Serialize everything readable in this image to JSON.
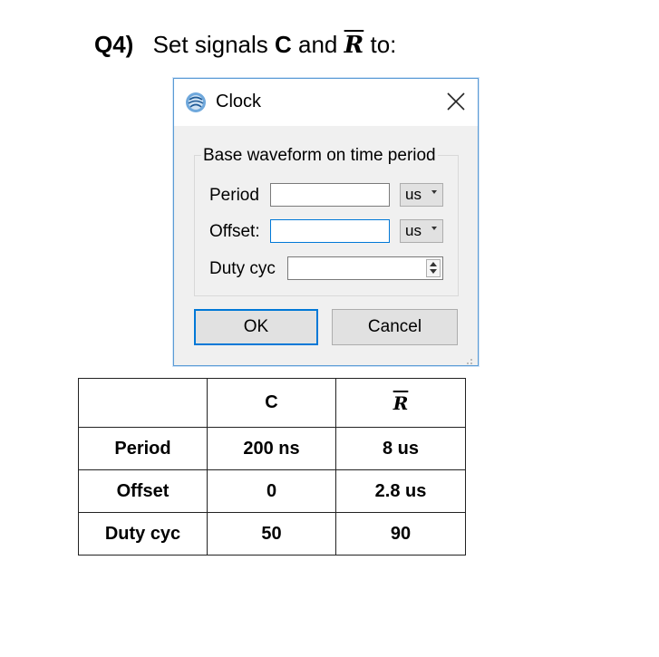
{
  "heading": {
    "qnum": "Q4)",
    "pre": "Set signals",
    "signal_c": "C",
    "and": "and",
    "signal_r": "R",
    "post": "to:"
  },
  "dialog": {
    "title": "Clock",
    "close_glyph": "✕",
    "group_label": "Base waveform on time period",
    "fields": {
      "period": {
        "label": "Period",
        "value": "",
        "unit": "us"
      },
      "offset": {
        "label": "Offset:",
        "value": "",
        "unit": "us"
      },
      "duty": {
        "label": "Duty cyc",
        "value": ""
      }
    },
    "ok_label": "OK",
    "cancel_label": "Cancel",
    "accent_color": "#0078d7"
  },
  "table": {
    "columns": [
      "",
      "C",
      "R"
    ],
    "rows": [
      {
        "label": "Period",
        "c": "200 ns",
        "r": "8 us"
      },
      {
        "label": "Offset",
        "c": "0",
        "r": "2.8 us"
      },
      {
        "label": "Duty cyc",
        "c": "50",
        "r": "90"
      }
    ]
  }
}
